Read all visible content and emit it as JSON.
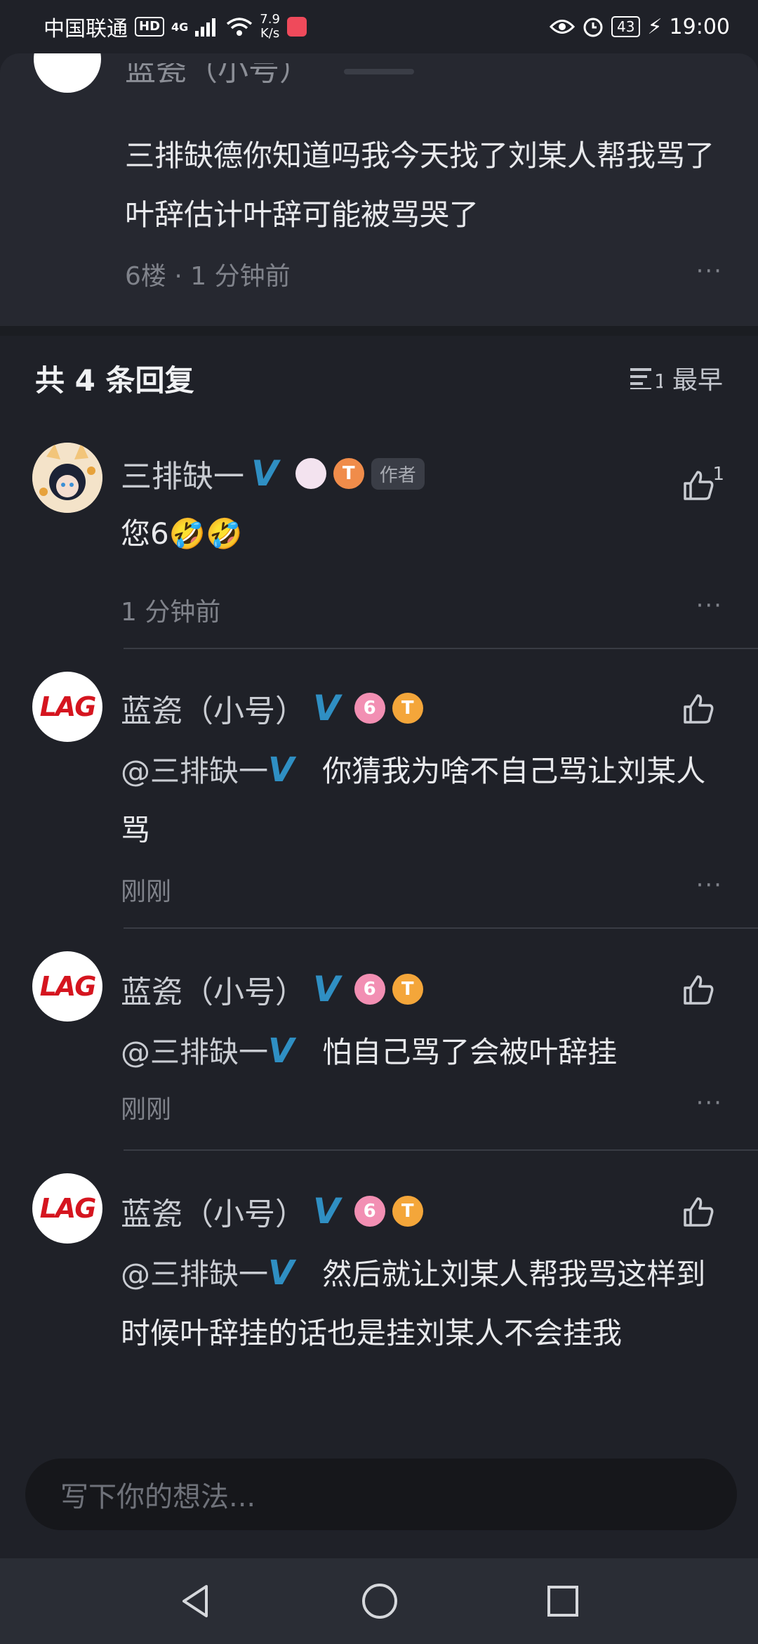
{
  "status_bar": {
    "carrier": "中国联通",
    "hd": "HD",
    "network": "4G",
    "speed_value": "7.9",
    "speed_unit": "K/s",
    "battery": "43",
    "time": "19:00"
  },
  "post": {
    "partial_name": "蓝瓷（小号）",
    "text": "三排缺德你知道吗我今天找了刘某人帮我骂了叶辞估计叶辞可能被骂哭了",
    "meta": "6楼 · 1 分钟前",
    "more": "···"
  },
  "replies_header": {
    "title": "共 4 条回复",
    "sort_label": "最早"
  },
  "replies": [
    {
      "name": "三排缺一",
      "author_tag": "作者",
      "content": "您6🤣🤣",
      "meta": "1 分钟前",
      "like_count": "1",
      "more": "···"
    },
    {
      "name": "蓝瓷（小号）",
      "mention": "@三排缺一",
      "content": "你猜我为啥不自己骂让刘某人骂",
      "meta": "刚刚",
      "more": "···"
    },
    {
      "name": "蓝瓷（小号）",
      "mention": "@三排缺一",
      "content": "怕自己骂了会被叶辞挂",
      "meta": "刚刚",
      "more": "···"
    },
    {
      "name": "蓝瓷（小号）",
      "mention": "@三排缺一",
      "content": "然后就让刘某人帮我骂这样到时候叶辞挂的话也是挂刘某人不会挂我"
    }
  ],
  "badges": {
    "verified": "V",
    "level6": "6",
    "levelT": "T"
  },
  "avatar_lag_text": "LAG",
  "comment_input": {
    "placeholder": "写下你的想法..."
  },
  "colors": {
    "background": "#1f2128",
    "panel": "#262830",
    "verified": "#2f8fc3"
  }
}
